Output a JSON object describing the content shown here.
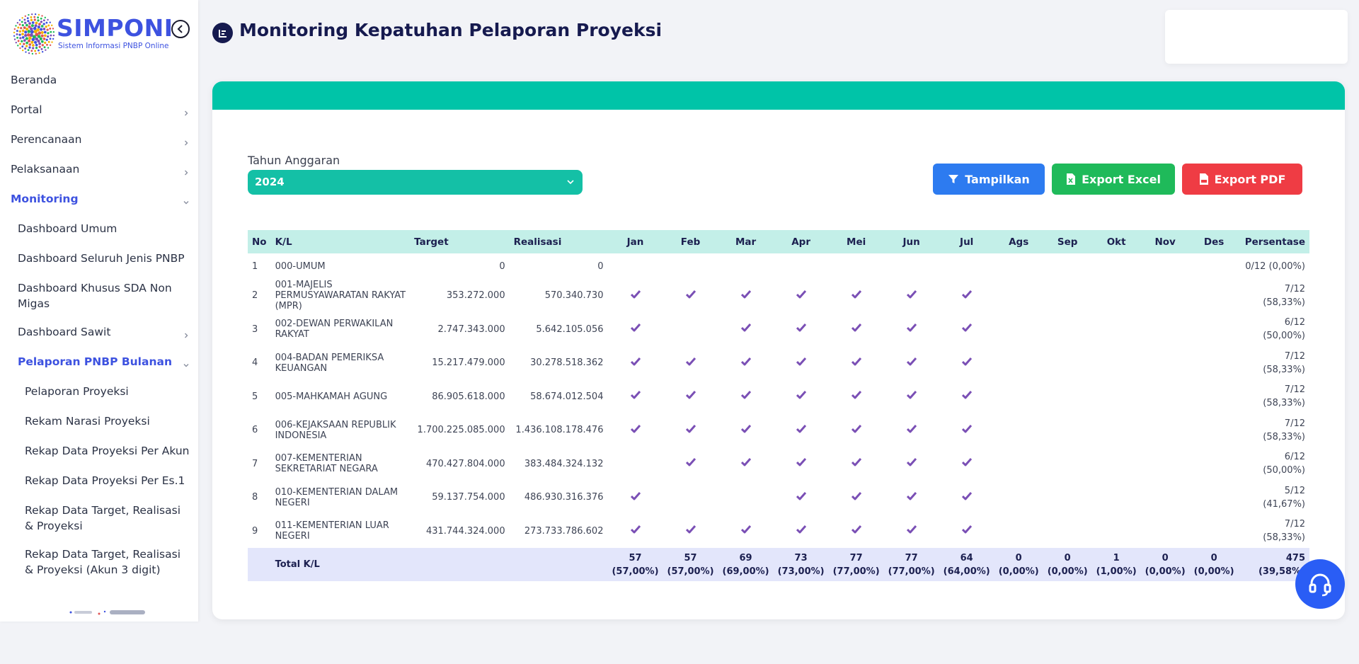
{
  "brand": {
    "name": "SIMPONI",
    "subtitle": "Sistem Informasi PNBP Online"
  },
  "sidebar": {
    "items": [
      {
        "label": "Beranda",
        "level": 0,
        "chevron": "none",
        "active": false,
        "top": 0
      },
      {
        "label": "Portal",
        "level": 0,
        "chevron": "right",
        "active": false
      },
      {
        "label": "Perencanaan",
        "level": 0,
        "chevron": "right",
        "active": false
      },
      {
        "label": "Pelaksanaan",
        "level": 0,
        "chevron": "right",
        "active": false
      },
      {
        "label": "Monitoring",
        "level": 0,
        "chevron": "down",
        "active": true
      },
      {
        "label": "Dashboard Umum",
        "level": 1,
        "chevron": "none",
        "active": false
      },
      {
        "label": "Dashboard Seluruh Jenis PNBP",
        "level": 1,
        "chevron": "none",
        "active": false
      },
      {
        "label": "Dashboard Khusus SDA Non Migas",
        "level": 1,
        "chevron": "none",
        "active": false
      },
      {
        "label": "Dashboard Sawit",
        "level": 1,
        "chevron": "right",
        "active": false
      },
      {
        "label": "Pelaporan PNBP Bulanan",
        "level": 1,
        "chevron": "down",
        "active": true
      },
      {
        "label": "Pelaporan Proyeksi",
        "level": 2,
        "chevron": "none",
        "active": false
      },
      {
        "label": "Rekam Narasi Proyeksi",
        "level": 2,
        "chevron": "none",
        "active": false
      },
      {
        "label": "Rekap Data Proyeksi Per Akun",
        "level": 2,
        "chevron": "none",
        "active": false
      },
      {
        "label": "Rekap Data Proyeksi Per Es.1",
        "level": 2,
        "chevron": "none",
        "active": false
      },
      {
        "label": "Rekap Data Target, Realisasi & Proyeksi",
        "level": 2,
        "chevron": "none",
        "active": false
      },
      {
        "label": "Rekap Data Target, Realisasi & Proyeksi (Akun 3 digit)",
        "level": 2,
        "chevron": "none",
        "active": false
      }
    ]
  },
  "page": {
    "title": "Monitoring Kepatuhan Pelaporan Proyeksi"
  },
  "filter": {
    "label": "Tahun Anggaran",
    "selected_year": "2024"
  },
  "buttons": {
    "tampilkan": "Tampilkan",
    "export_excel": "Export Excel",
    "export_pdf": "Export PDF"
  },
  "colors": {
    "brand": "#3d52e0",
    "teal": "#00c4a8",
    "check": "#7a4fb5"
  },
  "table": {
    "headers": [
      "No",
      "K/L",
      "Target",
      "Realisasi",
      "Jan",
      "Feb",
      "Mar",
      "Apr",
      "Mei",
      "Jun",
      "Jul",
      "Ags",
      "Sep",
      "Okt",
      "Nov",
      "Des",
      "Persentase"
    ],
    "rows": [
      {
        "no": "1",
        "kl": "000-UMUM",
        "target": "0",
        "realisasi": "0",
        "months": [
          0,
          0,
          0,
          0,
          0,
          0,
          0,
          0,
          0,
          0,
          0,
          0
        ],
        "pct1": "0/12 (0,00%)",
        "pct2": ""
      },
      {
        "no": "2",
        "kl": "001-MAJELIS PERMUSYAWARATAN RAKYAT (MPR)",
        "target": "353.272.000",
        "realisasi": "570.340.730",
        "months": [
          1,
          1,
          1,
          1,
          1,
          1,
          1,
          0,
          0,
          0,
          0,
          0
        ],
        "pct1": "7/12",
        "pct2": "(58,33%)"
      },
      {
        "no": "3",
        "kl": "002-DEWAN PERWAKILAN RAKYAT",
        "target": "2.747.343.000",
        "realisasi": "5.642.105.056",
        "months": [
          1,
          0,
          1,
          1,
          1,
          1,
          1,
          0,
          0,
          0,
          0,
          0
        ],
        "pct1": "6/12",
        "pct2": "(50,00%)"
      },
      {
        "no": "4",
        "kl": "004-BADAN PEMERIKSA KEUANGAN",
        "target": "15.217.479.000",
        "realisasi": "30.278.518.362",
        "months": [
          1,
          1,
          1,
          1,
          1,
          1,
          1,
          0,
          0,
          0,
          0,
          0
        ],
        "pct1": "7/12",
        "pct2": "(58,33%)"
      },
      {
        "no": "5",
        "kl": "005-MAHKAMAH AGUNG",
        "target": "86.905.618.000",
        "realisasi": "58.674.012.504",
        "months": [
          1,
          1,
          1,
          1,
          1,
          1,
          1,
          0,
          0,
          0,
          0,
          0
        ],
        "pct1": "7/12",
        "pct2": "(58,33%)"
      },
      {
        "no": "6",
        "kl": "006-KEJAKSAAN REPUBLIK INDONESIA",
        "target": "1.700.225.085.000",
        "realisasi": "1.436.108.178.476",
        "months": [
          1,
          1,
          1,
          1,
          1,
          1,
          1,
          0,
          0,
          0,
          0,
          0
        ],
        "pct1": "7/12",
        "pct2": "(58,33%)"
      },
      {
        "no": "7",
        "kl": "007-KEMENTERIAN SEKRETARIAT NEGARA",
        "target": "470.427.804.000",
        "realisasi": "383.484.324.132",
        "months": [
          0,
          1,
          1,
          1,
          1,
          1,
          1,
          0,
          0,
          0,
          0,
          0
        ],
        "pct1": "6/12",
        "pct2": "(50,00%)"
      },
      {
        "no": "8",
        "kl": "010-KEMENTERIAN DALAM NEGERI",
        "target": "59.137.754.000",
        "realisasi": "486.930.316.376",
        "months": [
          1,
          0,
          0,
          1,
          1,
          1,
          1,
          0,
          0,
          0,
          0,
          0
        ],
        "pct1": "5/12",
        "pct2": "(41,67%)"
      },
      {
        "no": "9",
        "kl": "011-KEMENTERIAN LUAR NEGERI",
        "target": "431.744.324.000",
        "realisasi": "273.733.786.602",
        "months": [
          1,
          1,
          1,
          1,
          1,
          1,
          1,
          0,
          0,
          0,
          0,
          0
        ],
        "pct1": "7/12",
        "pct2": "(58,33%)"
      }
    ],
    "total": {
      "label": "Total K/L",
      "months": [
        {
          "count": "57",
          "pct": "(57,00%)"
        },
        {
          "count": "57",
          "pct": "(57,00%)"
        },
        {
          "count": "69",
          "pct": "(69,00%)"
        },
        {
          "count": "73",
          "pct": "(73,00%)"
        },
        {
          "count": "77",
          "pct": "(77,00%)"
        },
        {
          "count": "77",
          "pct": "(77,00%)"
        },
        {
          "count": "64",
          "pct": "(64,00%)"
        },
        {
          "count": "0",
          "pct": "(0,00%)"
        },
        {
          "count": "0",
          "pct": "(0,00%)"
        },
        {
          "count": "1",
          "pct": "(1,00%)"
        },
        {
          "count": "0",
          "pct": "(0,00%)"
        },
        {
          "count": "0",
          "pct": "(0,00%)"
        }
      ],
      "overall_count": "475",
      "overall_pct": "(39,58%)"
    }
  }
}
